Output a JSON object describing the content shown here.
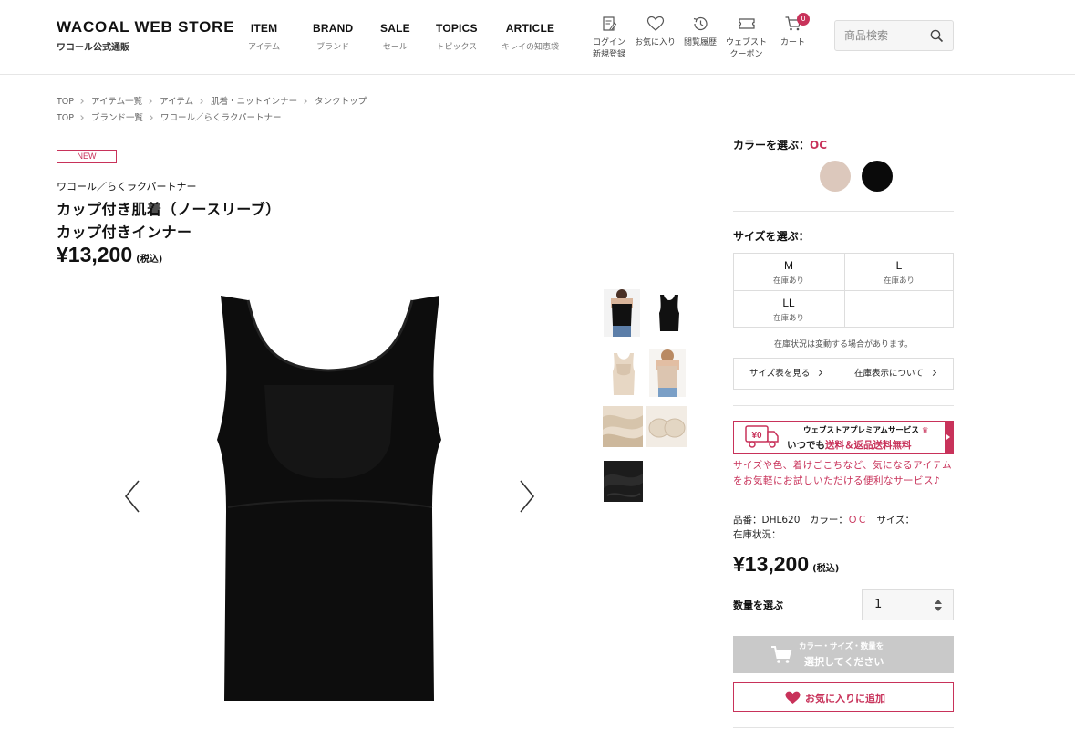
{
  "header": {
    "logo_main": "WACOAL WEB STORE",
    "logo_sub": "ワコール公式通販",
    "nav": [
      {
        "en": "ITEM",
        "ja": "アイテム"
      },
      {
        "en": "BRAND",
        "ja": "ブランド"
      },
      {
        "en": "SALE",
        "ja": "セール"
      },
      {
        "en": "TOPICS",
        "ja": "トピックス"
      },
      {
        "en": "ARTICLE",
        "ja": "キレイの知恵袋"
      }
    ],
    "utils": {
      "login": "ログイン",
      "register": "新規登録",
      "favorites": "お気に入り",
      "history": "閲覧履歴",
      "coupon_1": "ウェブスト",
      "coupon_2": "クーポン",
      "cart": "カート",
      "cart_count": "0"
    },
    "search_placeholder": "商品検索"
  },
  "breadcrumbs": {
    "row1": [
      "TOP",
      "アイテム一覧",
      "アイテム",
      "肌着・ニットインナー",
      "タンクトップ"
    ],
    "row2": [
      "TOP",
      "ブランド一覧",
      "ワコール／らくラクパートナー"
    ]
  },
  "product": {
    "badge": "NEW",
    "brand": "ワコール／らくラクパートナー",
    "title_line1": "カップ付き肌着（ノースリーブ）",
    "title_line2": "カップ付きインナー",
    "price": "¥13,200",
    "tax": "(税込)"
  },
  "options": {
    "color_label": "カラーを選ぶ：",
    "color_selected": "OC",
    "colors": [
      {
        "name": "OC",
        "hex": "#dcc8bc"
      },
      {
        "name": "black",
        "hex": "#0a0a0a"
      }
    ],
    "size_label": "サイズを選ぶ：",
    "sizes": [
      {
        "size": "M",
        "stock": "在庫あり"
      },
      {
        "size": "L",
        "stock": "在庫あり"
      },
      {
        "size": "LL",
        "stock": "在庫あり"
      }
    ],
    "stock_note": "在庫状況は変動する場合があります。",
    "size_chart_link": "サイズ表を見る",
    "stock_display_link": "在庫表示について"
  },
  "premium": {
    "badge_text": "¥0",
    "title": "ウェブストアプレミアムサービス",
    "line_prefix": "いつでも",
    "line_highlight": "送料＆返品送料無料",
    "description": "サイズや色、着けごこちなど、気になるアイテムをお気軽にお試しいただける便利なサービス♪"
  },
  "details": {
    "sku_label": "品番：",
    "sku": "DHL620",
    "color_label": "カラー：",
    "color": "ＯＣ",
    "size_label": "サイズ：",
    "stock_label": "在庫状況：",
    "price": "¥13,200",
    "tax": "(税込)"
  },
  "purchase": {
    "qty_label": "数量を選ぶ",
    "qty_value": "1",
    "cart_line1": "カラー・サイズ・数量を",
    "cart_line2": "選択してください",
    "favorite_label": "お気に入りに追加"
  },
  "colors": {
    "accent": "#c8325a",
    "disabled_button": "#c9c9c9"
  }
}
